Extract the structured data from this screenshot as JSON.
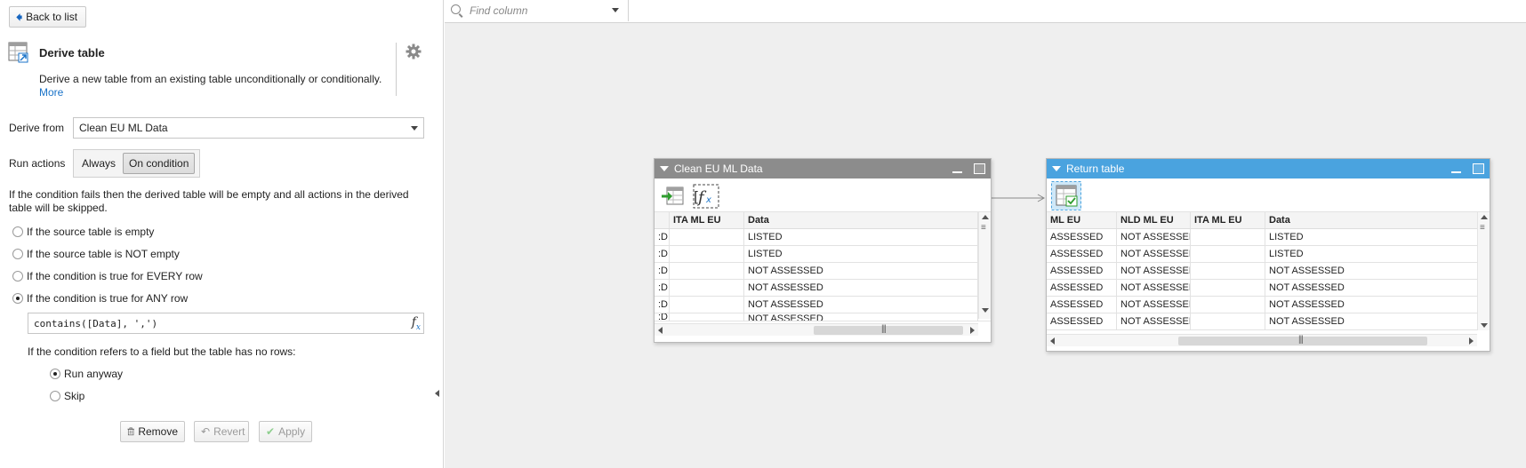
{
  "left": {
    "back_label": "Back to list",
    "title": "Derive table",
    "description": "Derive a new table from an existing table unconditionally or conditionally.",
    "more_link": "More",
    "derive_from_label": "Derive from",
    "derive_from_value": "Clean EU ML Data",
    "run_actions_label": "Run actions",
    "run_always": "Always",
    "run_on_condition": "On condition",
    "note_line1": "If the condition fails then the derived table will be empty and all actions in the derived",
    "note_line2": "table will be skipped.",
    "options": [
      "If the source table is empty",
      "If the source table is NOT empty",
      "If the condition is true for EVERY row",
      "If the condition is true for ANY row"
    ],
    "formula": "contains([Data], ',')",
    "no_rows_label": "If the condition refers to a field but the table has no rows:",
    "run_anyway": "Run anyway",
    "skip": "Skip",
    "remove_label": "Remove",
    "revert_label": "Revert",
    "apply_label": "Apply"
  },
  "canvas": {
    "find_placeholder": "Find column",
    "source_node": {
      "title": "Clean EU ML Data",
      "headers": [
        "",
        "ITA ML EU",
        "Data"
      ],
      "rows": [
        [
          ":D",
          "",
          "LISTED"
        ],
        [
          ":D",
          "",
          "LISTED"
        ],
        [
          ":D",
          "",
          "NOT ASSESSED"
        ],
        [
          ":D",
          "",
          "NOT ASSESSED"
        ],
        [
          ":D",
          "",
          "NOT ASSESSED"
        ],
        [
          ":D",
          "",
          "NOT ASSESSED"
        ]
      ]
    },
    "return_node": {
      "title": "Return table",
      "headers": [
        "ML EU",
        "NLD ML EU",
        "ITA ML EU",
        "Data"
      ],
      "rows": [
        [
          "ASSESSED",
          "NOT ASSESSED",
          "",
          "LISTED"
        ],
        [
          "ASSESSED",
          "NOT ASSESSED",
          "",
          "LISTED"
        ],
        [
          "ASSESSED",
          "NOT ASSESSED",
          "",
          "NOT ASSESSED"
        ],
        [
          "ASSESSED",
          "NOT ASSESSED",
          "",
          "NOT ASSESSED"
        ],
        [
          "ASSESSED",
          "NOT ASSESSED",
          "",
          "NOT ASSESSED"
        ],
        [
          "ASSESSED",
          "NOT ASSESSED",
          "",
          "NOT ASSESSED"
        ]
      ]
    }
  },
  "colors": {
    "source_header": "#8c8c8c",
    "return_header": "#4aa3df",
    "link": "#1a73c8",
    "canvas_bg": "#efefef"
  },
  "icons": [
    "back-arrow-icon",
    "derive-table-icon",
    "gear-icon",
    "dropdown-caret-icon",
    "fx-icon",
    "trash-icon",
    "revert-icon",
    "check-icon",
    "search-icon",
    "collapse-panel-icon",
    "import-table-icon",
    "formula-icon",
    "return-table-icon",
    "minimize-icon",
    "maximize-icon",
    "add-node-icon"
  ]
}
